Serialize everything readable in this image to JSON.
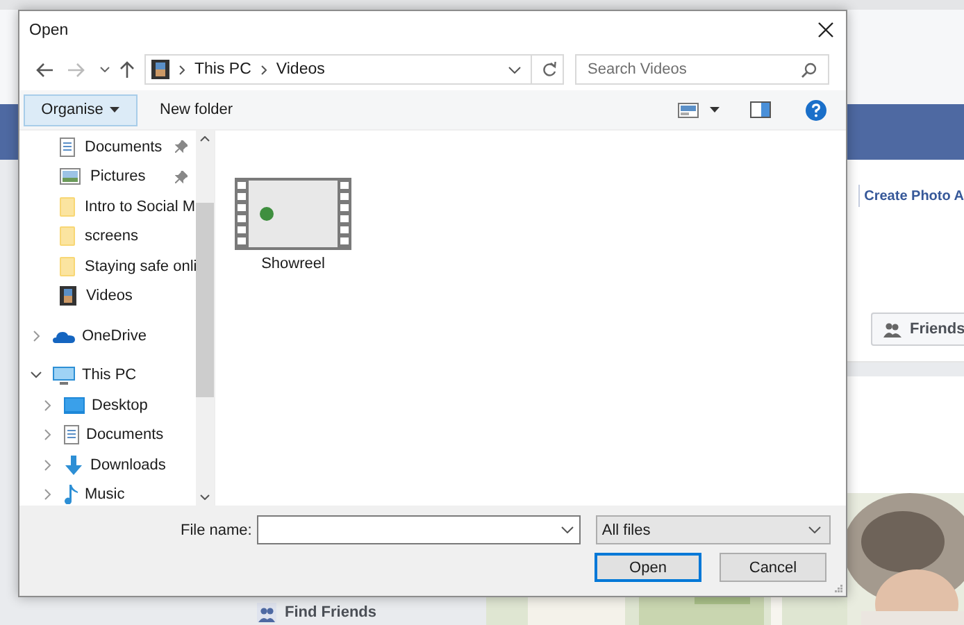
{
  "background_page": {
    "header_link": "Create Photo A",
    "friends_button": "Friends",
    "find_friends": "Find Friends"
  },
  "dialog": {
    "title": "Open",
    "address": {
      "path": [
        "This PC",
        "Videos"
      ]
    },
    "search": {
      "placeholder": "Search Videos"
    },
    "toolbar": {
      "organise": "Organise",
      "new_folder": "New folder"
    },
    "quick_access": [
      {
        "label": "Documents",
        "kind": "documents",
        "pinned": true
      },
      {
        "label": "Pictures",
        "kind": "pictures",
        "pinned": true
      },
      {
        "label": "Intro to Social M",
        "kind": "folder",
        "pinned": false
      },
      {
        "label": "screens",
        "kind": "folder",
        "pinned": false
      },
      {
        "label": "Staying safe onli",
        "kind": "folder",
        "pinned": false
      },
      {
        "label": "Videos",
        "kind": "videos",
        "pinned": false
      }
    ],
    "tree": [
      {
        "label": "OneDrive",
        "kind": "cloud",
        "expanded": false
      },
      {
        "label": "This PC",
        "kind": "computer",
        "expanded": true,
        "children": [
          {
            "label": "Desktop",
            "kind": "desktop",
            "expanded": false
          },
          {
            "label": "Documents",
            "kind": "documents",
            "expanded": false
          },
          {
            "label": "Downloads",
            "kind": "downloads",
            "expanded": false
          },
          {
            "label": "Music",
            "kind": "music",
            "expanded": false
          }
        ]
      }
    ],
    "files": [
      {
        "name": "Showreel",
        "kind": "video"
      }
    ],
    "file_name": {
      "label": "File name:"
    },
    "file_type": "All files",
    "buttons": [
      {
        "label": "Open",
        "default": true
      },
      {
        "label": "Cancel",
        "default": false
      }
    ]
  }
}
